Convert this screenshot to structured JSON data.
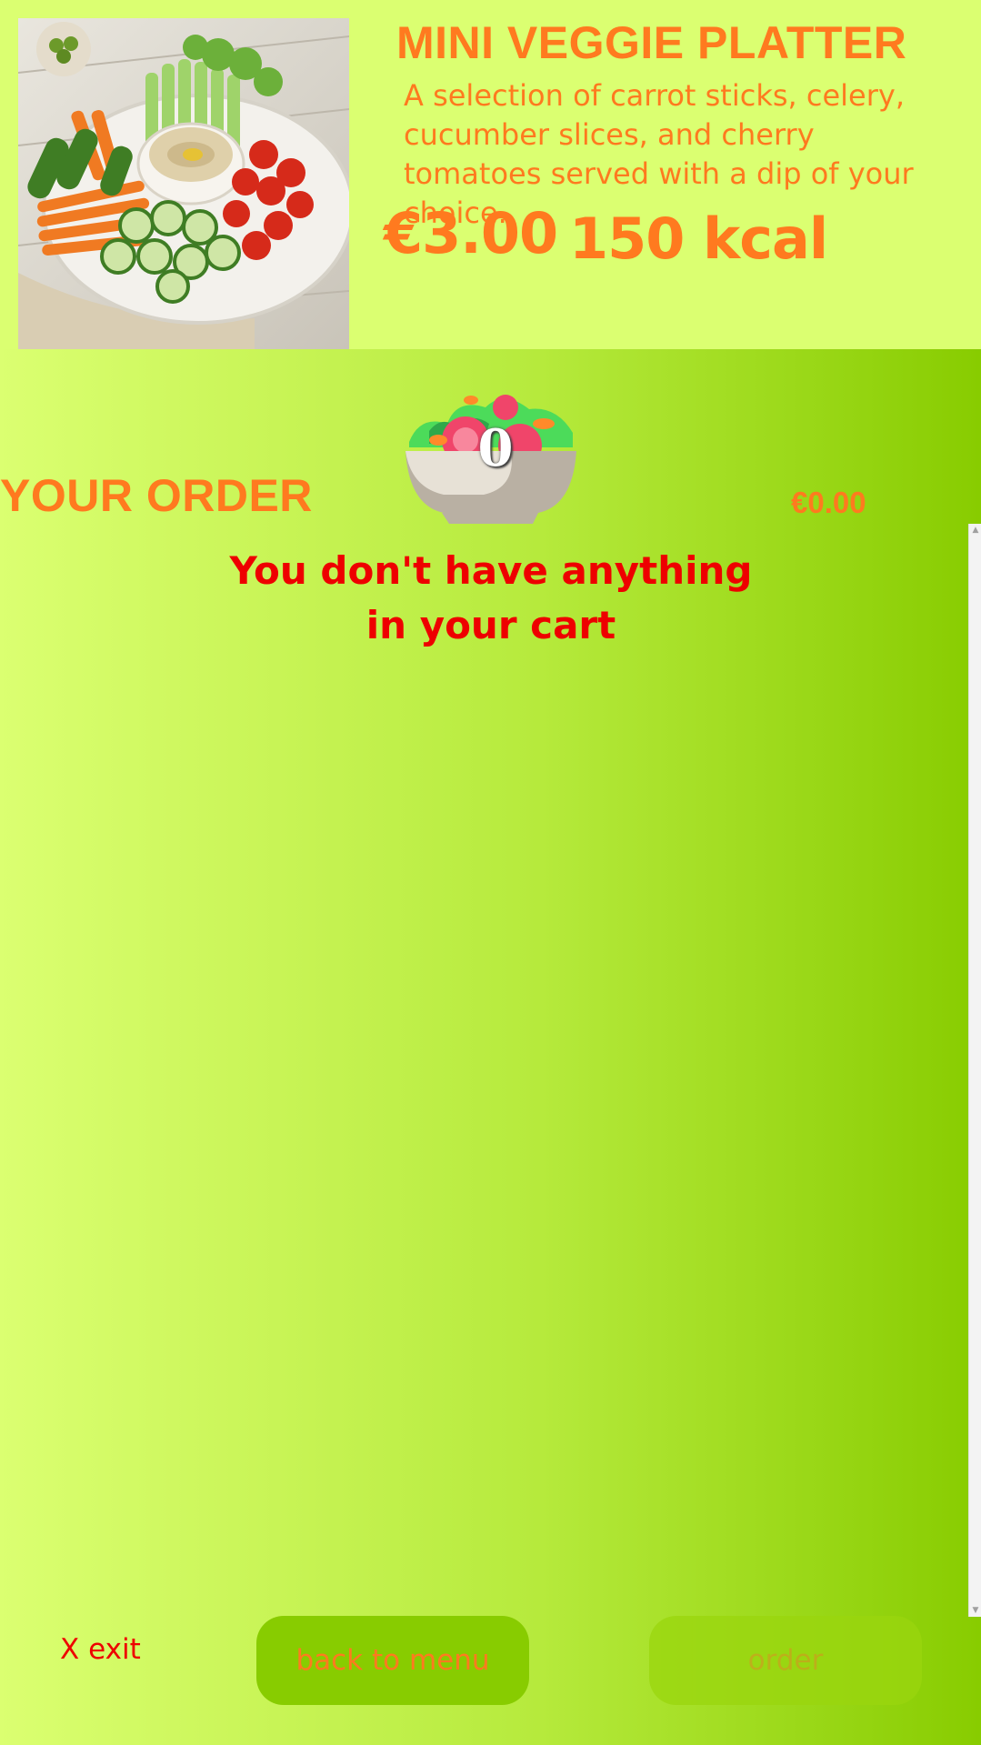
{
  "product": {
    "title": "MINI VEGGIE PLATTER",
    "description": "A selection of carrot sticks, celery, cucumber slices, and cherry tomatoes served with a dip of your choice.",
    "price": "€3.00",
    "kcal": "150 kcal"
  },
  "order": {
    "title": "YOUR ORDER",
    "cart_count": "0",
    "total": "€0.00",
    "empty_message": "You don't have anything in your cart"
  },
  "footer": {
    "exit_label": "X exit",
    "back_label": "back to menu",
    "order_label": "order",
    "order_enabled": false
  },
  "colors": {
    "accent_orange": "#ff7a1f",
    "alert_red": "#ee0000",
    "lime_light": "#dbff71",
    "lime_dark": "#88cc00"
  }
}
